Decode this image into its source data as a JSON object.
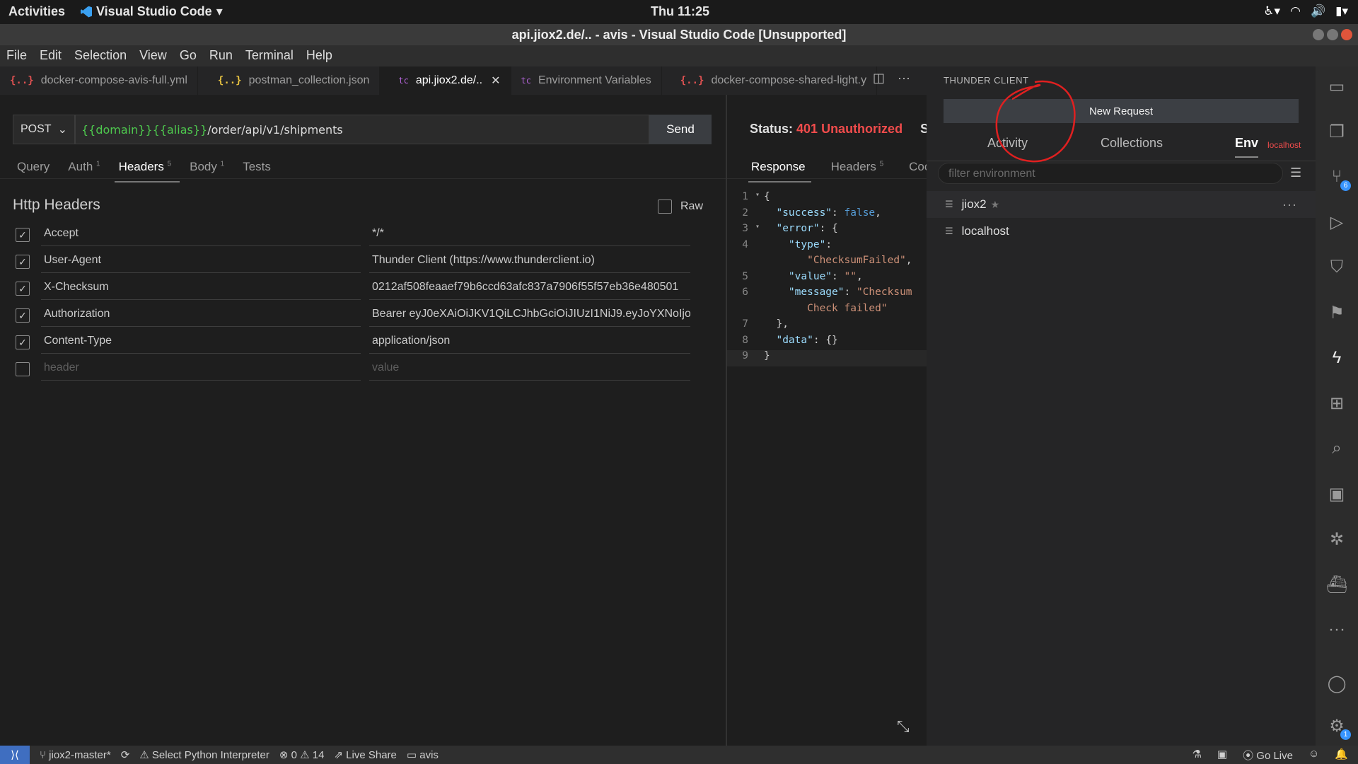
{
  "system": {
    "activities": "Activities",
    "app_name": "Visual Studio Code",
    "clock": "Thu 11:25"
  },
  "window": {
    "title": "api.jiox2.de/.. - avis - Visual Studio Code [Unsupported]"
  },
  "menu": [
    "File",
    "Edit",
    "Selection",
    "View",
    "Go",
    "Run",
    "Terminal",
    "Help"
  ],
  "tabs": [
    {
      "icon": "{..}",
      "label": "docker-compose-avis-full.yml",
      "icon_color": "#e05252"
    },
    {
      "icon": "{..}",
      "label": "postman_collection.json",
      "icon_color": "#e8c341"
    },
    {
      "icon": "tc",
      "label": "api.jiox2.de/..",
      "active": true
    },
    {
      "icon": "tc",
      "label": "Environment Variables"
    },
    {
      "icon": "{..}",
      "label": "docker-compose-shared-light.y",
      "icon_color": "#e05252"
    }
  ],
  "request": {
    "method": "POST",
    "url_var1": "{{domain}}",
    "url_var2": "{{alias}}",
    "url_path": "/order/api/v1/shipments",
    "send_label": "Send",
    "tabs": {
      "query": "Query",
      "auth": "Auth",
      "auth_count": "1",
      "headers": "Headers",
      "headers_count": "5",
      "body": "Body",
      "body_count": "1",
      "tests": "Tests"
    },
    "headers_title": "Http Headers",
    "raw_label": "Raw",
    "headers": [
      {
        "key": "Accept",
        "value": "*/*"
      },
      {
        "key": "User-Agent",
        "value": "Thunder Client (https://www.thunderclient.io)"
      },
      {
        "key": "X-Checksum",
        "value": "0212af508feaaef79b6ccd63afc837a7906f55f57eb36e480501"
      },
      {
        "key": "Authorization",
        "value": "Bearer eyJ0eXAiOiJKV1QiLCJhbGciOiJIUzI1NiJ9.eyJoYXNoIjo"
      },
      {
        "key": "Content-Type",
        "value": "application/json"
      }
    ],
    "new_header_placeholder": "header",
    "new_value_placeholder": "value"
  },
  "response": {
    "status_label": "Status:",
    "status_value": "401 Unauthorized",
    "size_label": "Siz",
    "tabs": {
      "response": "Response",
      "headers": "Headers",
      "headers_count": "5",
      "cookies": "Cook"
    },
    "line_numbers": [
      "1",
      "2",
      "3",
      "4",
      "",
      "5",
      "6",
      "",
      "7",
      "8",
      "9"
    ]
  },
  "thunder": {
    "title": "THUNDER CLIENT",
    "new_request": "New Request",
    "tab_activity": "Activity",
    "tab_collections": "Collections",
    "tab_env": "Env",
    "active_env": "localhost",
    "filter_placeholder": "filter environment",
    "environments": [
      {
        "name": "jiox2",
        "star": "★",
        "more": "···"
      },
      {
        "name": "localhost"
      }
    ]
  },
  "activitybar": {
    "source_control_badge": "6",
    "settings_badge": "1"
  },
  "statusbar": {
    "branch": "jiox2-master*",
    "python": "Select Python Interpreter",
    "errors": "0",
    "warnings": "14",
    "liveshare": "Live Share",
    "folder": "avis",
    "golive": "Go Live"
  },
  "colors": {
    "accent_blue": "#3f6ec0",
    "error_red": "#f14c4c",
    "env_var_green": "#4ec94e"
  }
}
